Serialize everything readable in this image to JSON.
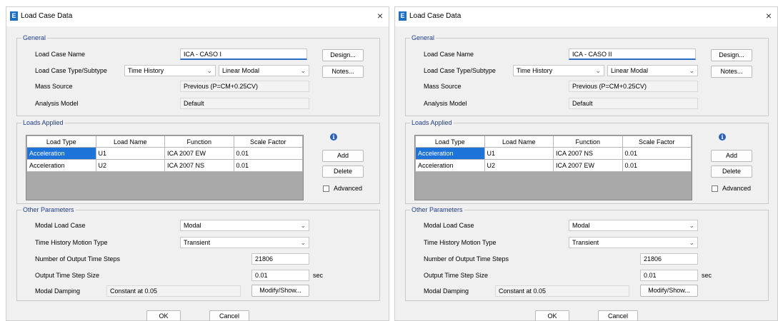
{
  "dialogs": [
    {
      "title": "Load Case Data",
      "app_icon": "E",
      "close": "×",
      "general": {
        "title": "General",
        "load_case_name_label": "Load Case Name",
        "load_case_name": "ICA - CASO I",
        "type_label": "Load Case Type/Subtype",
        "type": "Time History",
        "subtype": "Linear Modal",
        "mass_source_label": "Mass Source",
        "mass_source": "Previous  (P=CM+0.25CV)",
        "analysis_model_label": "Analysis Model",
        "analysis_model": "Default",
        "design_button": "Design...",
        "notes_button": "Notes..."
      },
      "loads": {
        "title": "Loads Applied",
        "columns": [
          "Load Type",
          "Load Name",
          "Function",
          "Scale Factor"
        ],
        "rows": [
          [
            "Acceleration",
            "U1",
            "ICA 2007 EW",
            "0.01"
          ],
          [
            "Acceleration",
            "U2",
            "ICA 2007 NS",
            "0.01"
          ]
        ],
        "add_button": "Add",
        "delete_button": "Delete",
        "advanced_label": "Advanced",
        "info_glyph": "i"
      },
      "other": {
        "title": "Other Parameters",
        "modal_load_case_label": "Modal Load Case",
        "modal_load_case": "Modal",
        "motion_type_label": "Time History Motion Type",
        "motion_type": "Transient",
        "output_steps_label": "Number of Output Time Steps",
        "output_steps": "21806",
        "step_size_label": "Output Time Step Size",
        "step_size": "0.01",
        "step_unit": "sec",
        "damping_label": "Modal Damping",
        "damping": "Constant at 0.05",
        "modify_button": "Modify/Show..."
      },
      "ok_button": "OK",
      "cancel_button": "Cancel"
    },
    {
      "title": "Load Case Data",
      "app_icon": "E",
      "close": "×",
      "general": {
        "title": "General",
        "load_case_name_label": "Load Case Name",
        "load_case_name": "ICA - CASO II",
        "type_label": "Load Case Type/Subtype",
        "type": "Time History",
        "subtype": "Linear Modal",
        "mass_source_label": "Mass Source",
        "mass_source": "Previous  (P=CM+0.25CV)",
        "analysis_model_label": "Analysis Model",
        "analysis_model": "Default",
        "design_button": "Design...",
        "notes_button": "Notes..."
      },
      "loads": {
        "title": "Loads Applied",
        "columns": [
          "Load Type",
          "Load Name",
          "Function",
          "Scale Factor"
        ],
        "rows": [
          [
            "Acceleration",
            "U1",
            "ICA 2007 NS",
            "0.01"
          ],
          [
            "Acceleration",
            "U2",
            "ICA 2007 EW",
            "0.01"
          ]
        ],
        "add_button": "Add",
        "delete_button": "Delete",
        "advanced_label": "Advanced",
        "info_glyph": "i"
      },
      "other": {
        "title": "Other Parameters",
        "modal_load_case_label": "Modal Load Case",
        "modal_load_case": "Modal",
        "motion_type_label": "Time History Motion Type",
        "motion_type": "Transient",
        "output_steps_label": "Number of Output Time Steps",
        "output_steps": "21806",
        "step_size_label": "Output Time Step Size",
        "step_size": "0.01",
        "step_unit": "sec",
        "damping_label": "Modal Damping",
        "damping": "Constant at 0.05",
        "modify_button": "Modify/Show..."
      },
      "ok_button": "OK",
      "cancel_button": "Cancel"
    }
  ]
}
